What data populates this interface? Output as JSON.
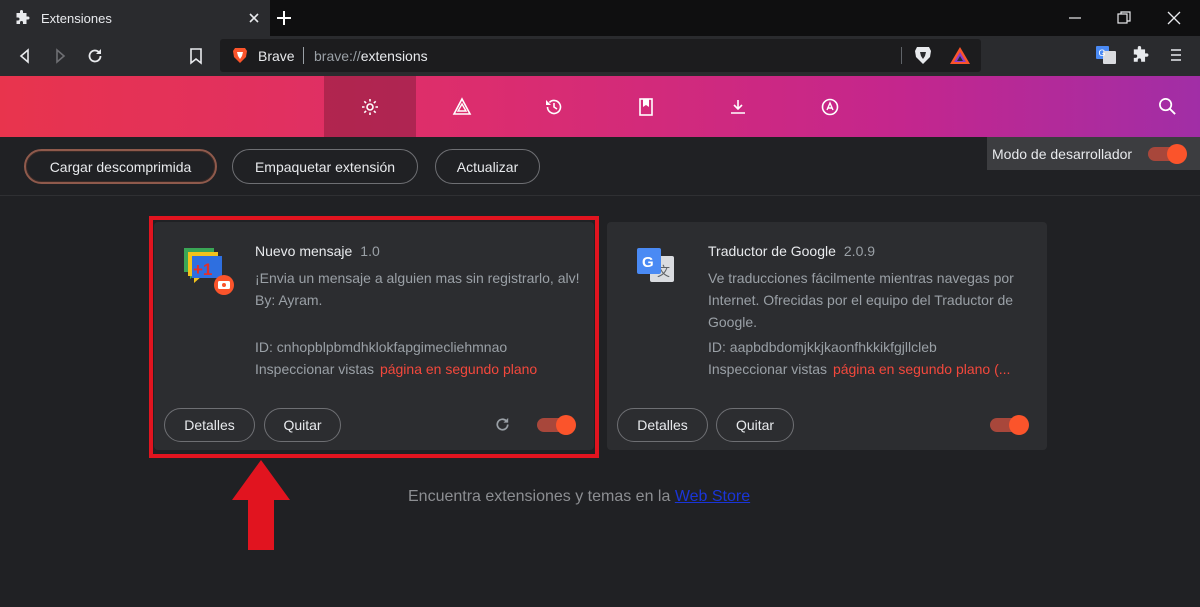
{
  "tab": {
    "title": "Extensiones"
  },
  "omnibox": {
    "brand": "Brave",
    "scheme": "brave://",
    "path": "extensions"
  },
  "actions": {
    "load_unpacked": "Cargar descomprimida",
    "pack": "Empaquetar extensión",
    "update": "Actualizar"
  },
  "devmode": {
    "label": "Modo de desarrollador",
    "enabled": true
  },
  "extensions": [
    {
      "name": "Nuevo mensaje",
      "version": "1.0",
      "description": "¡Envia un mensaje a alguien mas sin registrarlo, alv! By: Ayram.",
      "id": "ID: cnhopblpbmdhklokfapgimecliehmnao",
      "inspect_label": "Inspeccionar vistas",
      "inspect_link": "página en segundo plano",
      "details": "Detalles",
      "remove": "Quitar",
      "enabled": true
    },
    {
      "name": "Traductor de Google",
      "version": "2.0.9",
      "description": "Ve traducciones fácilmente mientras navegas por Internet. Ofrecidas por el equipo del Traductor de Google.",
      "id": "ID: aapbdbdomjkkjkaonfhkkikfgjllcleb",
      "inspect_label": "Inspeccionar vistas",
      "inspect_link": "página en segundo plano (...",
      "details": "Detalles",
      "remove": "Quitar",
      "enabled": true
    }
  ],
  "footer": {
    "text": "Encuentra extensiones y temas en la ",
    "link": "Web Store"
  },
  "colors": {
    "accent": "#fb542b",
    "highlight": "#e1141f",
    "link_red": "#f3483c"
  }
}
